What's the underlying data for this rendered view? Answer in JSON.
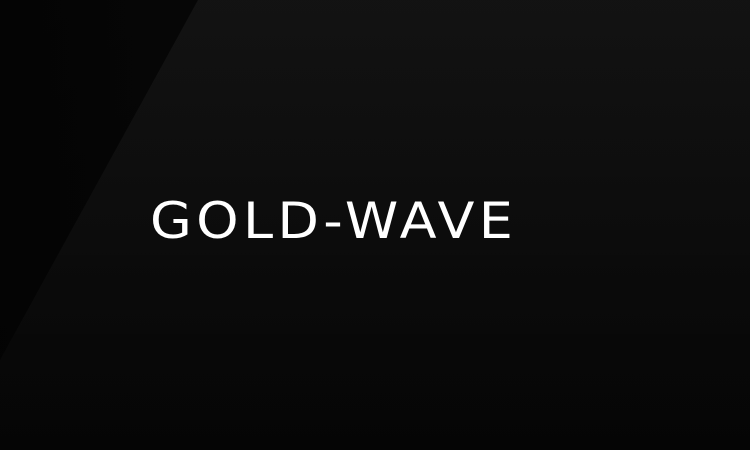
{
  "logo": {
    "wordmark": "GOLD-WAVE"
  },
  "colors": {
    "background": "#0a0a0a",
    "text": "#ffffff"
  }
}
